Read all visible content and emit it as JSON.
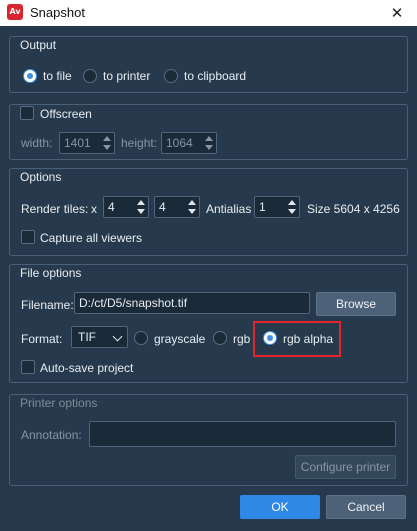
{
  "window": {
    "title": "Snapshot",
    "app_icon_text": "Av",
    "close_glyph": "✕"
  },
  "output": {
    "group_label": "Output",
    "options": [
      {
        "label": "to file",
        "checked": true
      },
      {
        "label": "to printer",
        "checked": false
      },
      {
        "label": "to clipboard",
        "checked": false
      }
    ]
  },
  "offscreen": {
    "label": "Offscreen",
    "checked": false,
    "width_label": "width:",
    "width_value": "1401",
    "height_label": "height:",
    "height_value": "1064"
  },
  "options_group": {
    "group_label": "Options",
    "render_tiles_label": "Render tiles:",
    "x_label": "x",
    "tiles_x": "4",
    "tiles_y": "4",
    "antialias_label": "Antialias",
    "antialias_value": "1",
    "size_text": "Size 5604 x 4256",
    "capture_all_label": "Capture all viewers",
    "capture_all_checked": false
  },
  "file_options": {
    "group_label": "File options",
    "filename_label": "Filename:",
    "filename_value": "D:/ct/D5/snapshot.tif",
    "browse_label": "Browse",
    "format_label": "Format:",
    "format_value": "TIF",
    "color_modes": [
      {
        "label": "grayscale",
        "checked": false
      },
      {
        "label": "rgb",
        "checked": false
      },
      {
        "label": "rgb alpha",
        "checked": true
      }
    ],
    "auto_save_label": "Auto-save project",
    "auto_save_checked": false
  },
  "printer_options": {
    "group_label": "Printer options",
    "annotation_label": "Annotation:",
    "annotation_value": "",
    "configure_label": "Configure printer"
  },
  "footer": {
    "ok_label": "OK",
    "cancel_label": "Cancel"
  },
  "colors": {
    "background": "#273a4d",
    "accent": "#2f88e6",
    "highlight": "#e3262b"
  }
}
